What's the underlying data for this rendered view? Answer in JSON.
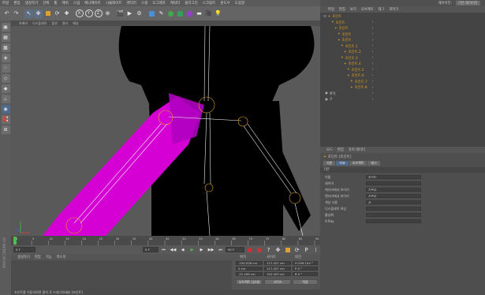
{
  "menubar": {
    "items": [
      "파일",
      "편집",
      "생성하기",
      "선택",
      "툴",
      "메쉬",
      "스냅",
      "애니메이트",
      "시뮬레이트",
      "렌더러",
      "스컬",
      "모그래프",
      "캐릭터",
      "플러그인",
      "스크립트",
      "윈도우",
      "도움말"
    ]
  },
  "right_header": {
    "layout_label": "레이아웃:",
    "layout_value": "기본 레이아웃"
  },
  "toolbar": {
    "icons": [
      "undo-icon",
      "redo-icon",
      "select-icon",
      "move-icon",
      "scale-icon",
      "rotate-icon",
      "recent-icon",
      "x-axis-icon",
      "y-axis-icon",
      "z-axis-icon",
      "world-icon",
      "render-view-icon",
      "render-icon",
      "render-settings-icon",
      "cube-icon",
      "pen-icon",
      "subdivision-icon",
      "array-icon",
      "deformer-icon",
      "floor-icon",
      "camera-icon",
      "light-icon"
    ]
  },
  "viewport_menu": {
    "items": [
      "카메라",
      "디스플레이",
      "옵션",
      "필터",
      "패널"
    ]
  },
  "object_manager": {
    "menu": [
      "파일",
      "편집",
      "보기",
      "오브젝트",
      "태그",
      "북마크"
    ],
    "rows": [
      {
        "label": "조인트",
        "indent": 6,
        "color": "#e0a020"
      },
      {
        "label": "조인트",
        "indent": 10,
        "color": "#e0a020"
      },
      {
        "label": "조인트",
        "indent": 14,
        "color": "#e0a020"
      },
      {
        "label": "조인트",
        "indent": 18,
        "color": "#e0a020"
      },
      {
        "label": "조인트",
        "indent": 18,
        "color": "#e0a020"
      },
      {
        "label": "조인트.1",
        "indent": 22,
        "color": "#e0a020"
      },
      {
        "label": "조인트.2",
        "indent": 26,
        "color": "#e0a020"
      },
      {
        "label": "조인트.3",
        "indent": 22,
        "color": "#e0a020"
      },
      {
        "label": "조인트.4",
        "indent": 26,
        "color": "#e0a020"
      },
      {
        "label": "조인트.5",
        "indent": 30,
        "color": "#e0a020"
      },
      {
        "label": "조인트.6",
        "indent": 30,
        "color": "#e0a020"
      },
      {
        "label": "조인트.7",
        "indent": 34,
        "color": "#e0a020"
      },
      {
        "label": "조인트.8",
        "indent": 34,
        "color": "#e0a020"
      },
      {
        "label": "바닥",
        "indent": 2,
        "color": "#c8c8c8"
      },
      {
        "label": "구",
        "indent": 2,
        "color": "#c8c8c8"
      }
    ]
  },
  "attributes": {
    "menu": [
      "모드",
      "편집",
      "유저 데이터"
    ],
    "object_name": "조인트 [조인트]",
    "tabs": [
      "기본",
      "좌표",
      "오브젝트",
      "태그"
    ],
    "active_tab": "좌표",
    "section": "기본",
    "fields": [
      {
        "label": "이름",
        "value": "조인트"
      },
      {
        "label": "레이어",
        "value": ""
      },
      {
        "label": "에디터에서 보이기",
        "value": "기본값"
      },
      {
        "label": "렌더러에서 보이기",
        "value": "기본값"
      },
      {
        "label": "색상 사용",
        "value": "끔"
      },
      {
        "label": "디스플레이 색상",
        "value": ""
      },
      {
        "label": "활성화",
        "value": ""
      },
      {
        "label": "X-Ray",
        "value": ""
      }
    ]
  },
  "timeline": {
    "ticks": [
      "0",
      "5",
      "10",
      "15",
      "20",
      "25",
      "30",
      "35",
      "40",
      "45",
      "50",
      "55",
      "60",
      "65",
      "70",
      "75",
      "80",
      "85",
      "90"
    ],
    "frame_label": "0 F",
    "start": "0 F",
    "end": "90 F"
  },
  "material_panel": {
    "menu": [
      "생성하기",
      "편집",
      "기능",
      "텍스처"
    ]
  },
  "coords": {
    "headers": [
      "위치",
      "사이즈",
      "회전"
    ],
    "rows": [
      {
        "a": "-150.028 cm",
        "b": "117.427 cm",
        "c": "H 299.154 °"
      },
      {
        "a": "0 cm",
        "b": "117.427 cm",
        "c": "P 0 °"
      },
      {
        "a": "-21.499 cm",
        "b": "192.403 cm",
        "c": "B 0 °"
      }
    ],
    "mode1": "오브젝트 (상대)",
    "mode2": "사이즈",
    "apply": "적용"
  },
  "status": {
    "text": "조인트를 이동하려면 클릭 후 드래그하세요 [조인트]"
  },
  "maxon": "MAXON CINEMA 4D"
}
